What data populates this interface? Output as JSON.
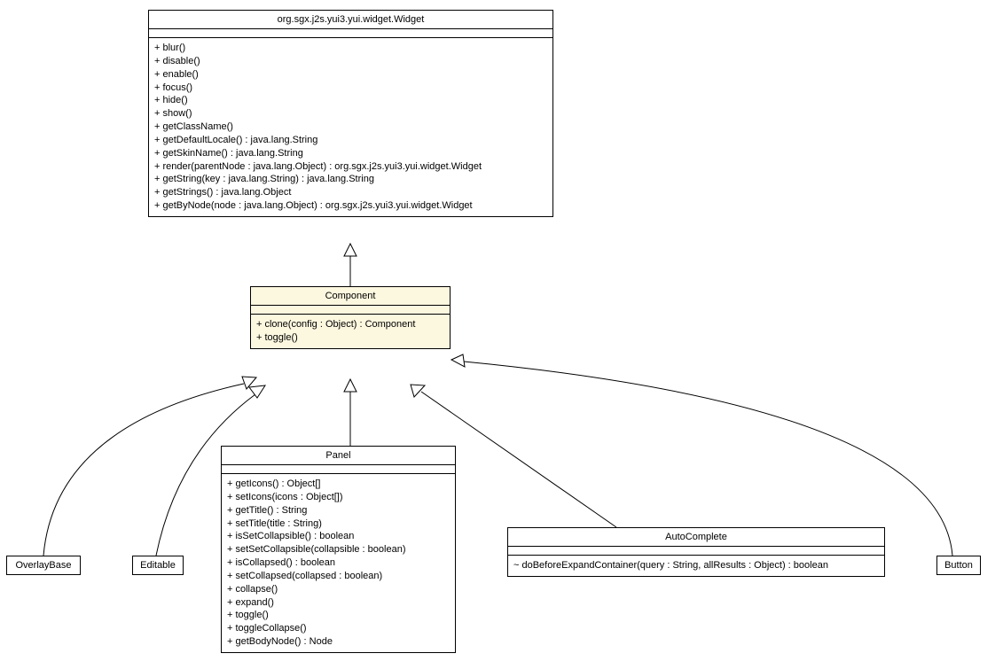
{
  "widget": {
    "title": "org.sgx.j2s.yui3.yui.widget.Widget",
    "ops": [
      "+ blur()",
      "+ disable()",
      "+ enable()",
      "+ focus()",
      "+ hide()",
      "+ show()",
      "+ getClassName()",
      "+ getDefaultLocale() : java.lang.String",
      "+ getSkinName() : java.lang.String",
      "+ render(parentNode : java.lang.Object) : org.sgx.j2s.yui3.yui.widget.Widget",
      "+ getString(key : java.lang.String) : java.lang.String",
      "+ getStrings() : java.lang.Object",
      "+ getByNode(node : java.lang.Object) : org.sgx.j2s.yui3.yui.widget.Widget"
    ]
  },
  "component": {
    "title": "Component",
    "ops": [
      "+ clone(config : Object) : Component",
      "+ toggle()"
    ]
  },
  "panel": {
    "title": "Panel",
    "ops": [
      "+ getIcons() : Object[]",
      "+ setIcons(icons : Object[])",
      "+ getTitle() : String",
      "+ setTitle(title : String)",
      "+ isSetCollapsible() : boolean",
      "+ setSetCollapsible(collapsible : boolean)",
      "+ isCollapsed() : boolean",
      "+ setCollapsed(collapsed : boolean)",
      "+ collapse()",
      "+ expand()",
      "+ toggle()",
      "+ toggleCollapse()",
      "+ getBodyNode() : Node"
    ]
  },
  "autocomplete": {
    "title": "AutoComplete",
    "ops": [
      "~ doBeforeExpandContainer(query : String, allResults : Object) : boolean"
    ]
  },
  "overlaybase": {
    "title": "OverlayBase"
  },
  "editable": {
    "title": "Editable"
  },
  "button": {
    "title": "Button"
  }
}
